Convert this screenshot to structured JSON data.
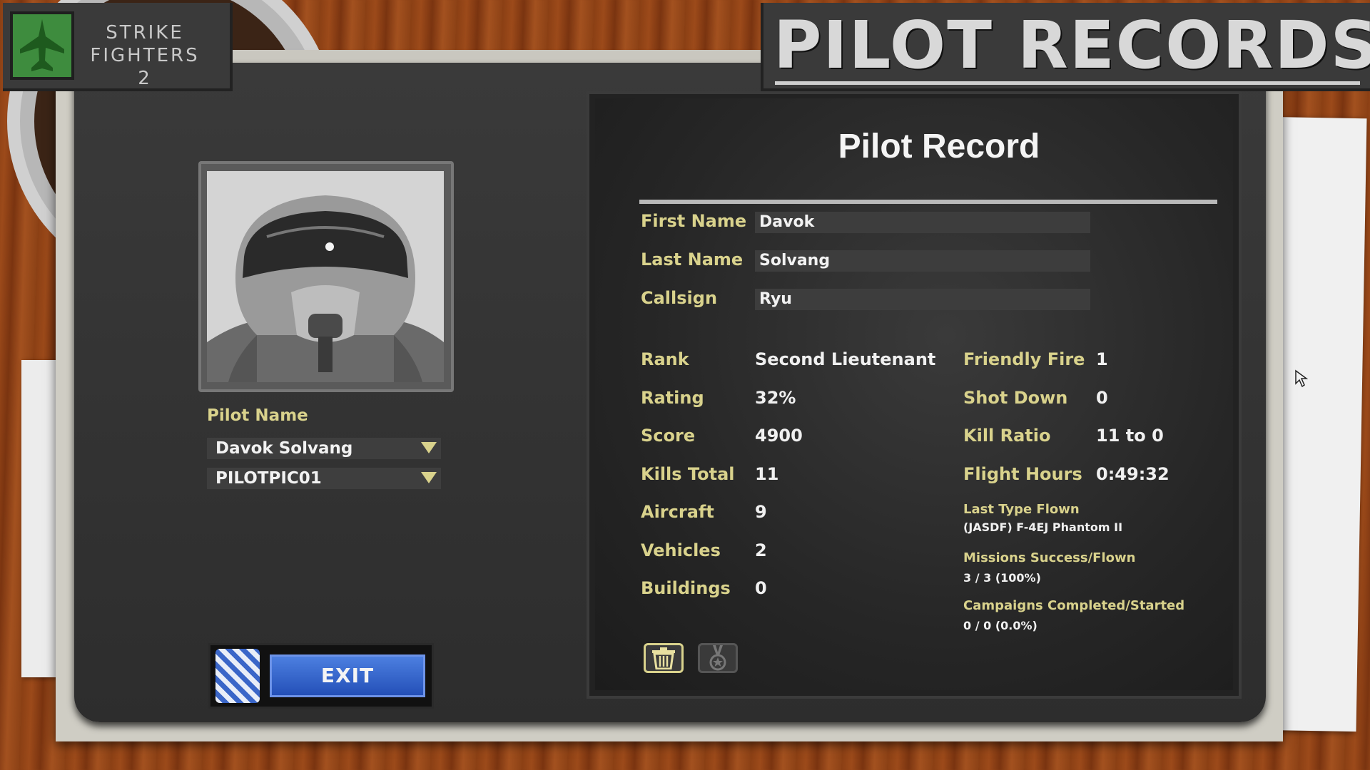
{
  "logo": {
    "line1": "STRIKE",
    "line2": "FIGHTERS",
    "line3": "2"
  },
  "banner": {
    "title": "PILOT RECORDS"
  },
  "left_panel": {
    "pilot_name_label": "Pilot Name",
    "pilot_select": "Davok Solvang",
    "picture_select": "PILOTPIC01",
    "exit_label": "EXIT"
  },
  "record": {
    "title": "Pilot Record",
    "first_name_label": "First Name",
    "first_name": "Davok",
    "last_name_label": "Last Name",
    "last_name": "Solvang",
    "callsign_label": "Callsign",
    "callsign": "Ryu",
    "stats_left": [
      {
        "label": "Rank",
        "value": "Second Lieutenant"
      },
      {
        "label": "Rating",
        "value": "32%"
      },
      {
        "label": "Score",
        "value": "4900"
      },
      {
        "label": "Kills Total",
        "value": "11"
      },
      {
        "label": "Aircraft",
        "value": "9"
      },
      {
        "label": "Vehicles",
        "value": "2"
      },
      {
        "label": "Buildings",
        "value": "0"
      }
    ],
    "stats_right": [
      {
        "label": "Friendly Fire",
        "value": "1"
      },
      {
        "label": "Shot Down",
        "value": "0"
      },
      {
        "label": "Kill Ratio",
        "value": "11 to 0"
      },
      {
        "label": "Flight Hours",
        "value": "0:49:32"
      }
    ],
    "last_type_label": "Last Type Flown",
    "last_type": "(JASDF) F-4EJ Phantom II",
    "missions_label": "Missions Success/Flown",
    "missions": "3 / 3 (100%)",
    "campaigns_label": "Campaigns Completed/Started",
    "campaigns": "0 / 0 (0.0%)"
  },
  "icons": {
    "delete": "trash-icon",
    "medals": "medal-icon",
    "logo": "jet-icon",
    "cursor": "mouse-cursor-icon"
  },
  "colors": {
    "label_yellow": "#d9d28c",
    "exit_blue": "#2f5fcb",
    "logo_green": "#3e8c3e"
  }
}
